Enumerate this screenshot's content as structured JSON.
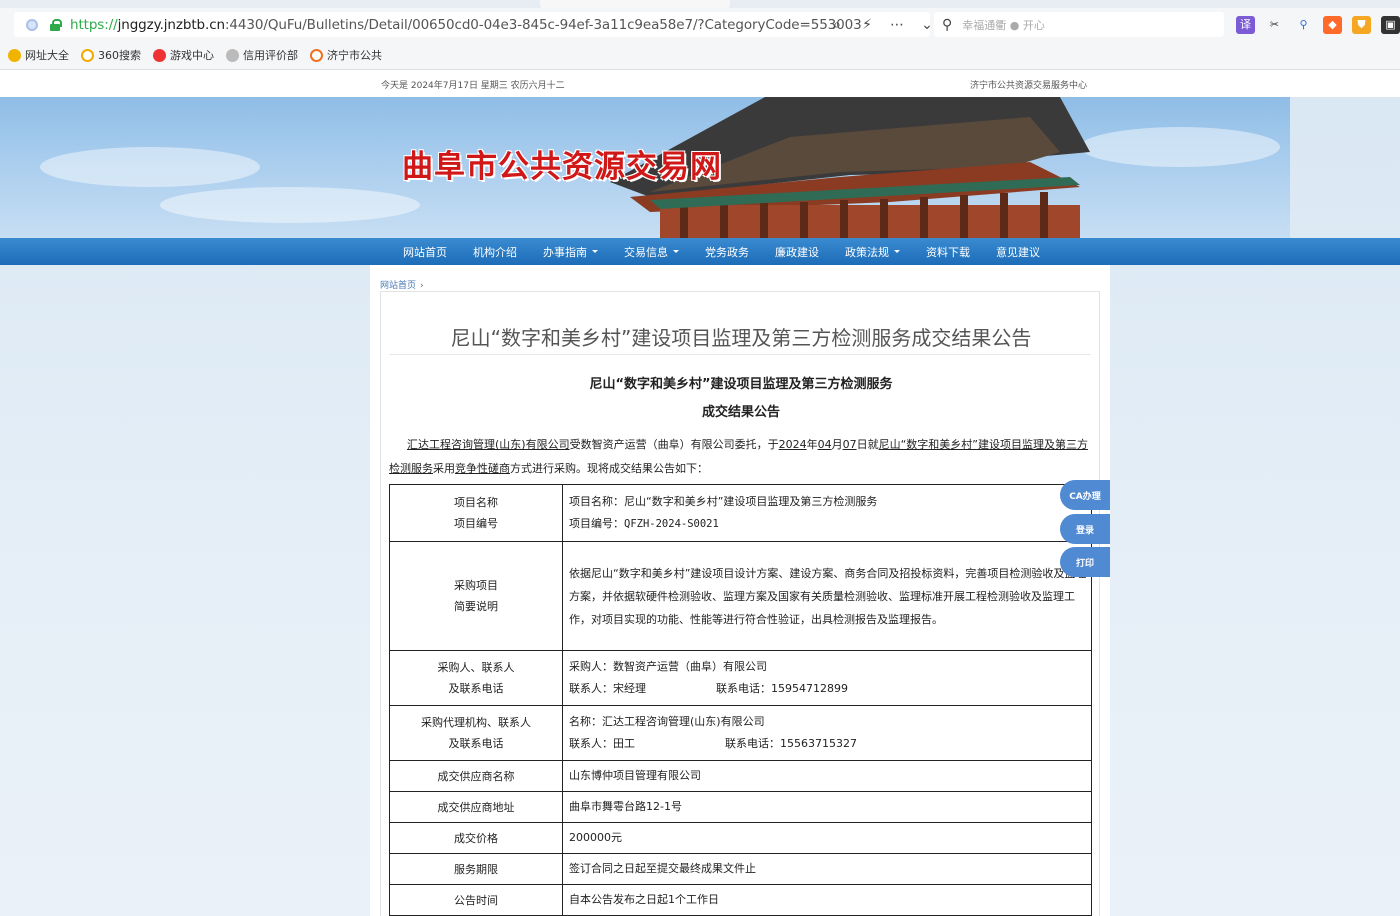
{
  "browser": {
    "url_protocol": "https://",
    "url_host": "jnggzy.jnzbtb.cn",
    "url_path": ":4430/QuFu/Bulletins/Detail/00650cd0-04e3-845c-94ef-3a11c9ea58e7/?CategoryCode=553003",
    "search_placeholder": "幸福通衢 ● 开心",
    "bookmarks": [
      "网址大全",
      "360搜索",
      "游戏中心",
      "信用评价部",
      "济宁市公共"
    ]
  },
  "site": {
    "date_line": "今天是  2024年7月17日  星期三  农历六月十二",
    "center_name": "济宁市公共资源交易服务中心",
    "banner_title": "曲阜市公共资源交易网",
    "nav": [
      {
        "label": "网站首页"
      },
      {
        "label": "机构介绍"
      },
      {
        "label": "办事指南",
        "dropdown": true
      },
      {
        "label": "交易信息",
        "dropdown": true
      },
      {
        "label": "党务政务"
      },
      {
        "label": "廉政建设"
      },
      {
        "label": "政策法规",
        "dropdown": true
      },
      {
        "label": "资料下载"
      },
      {
        "label": "意见建议"
      }
    ],
    "breadcrumb": "网站首页",
    "float_buttons": [
      "CA办理",
      "登录",
      "打印"
    ]
  },
  "notice": {
    "title": "尼山“数字和美乡村”建设项目监理及第三方检测服务成交结果公告",
    "subtitle1": "尼山“数字和美乡村”建设项目监理及第三方检测服务",
    "subtitle2": "成交结果公告",
    "intro": {
      "agent": "汇达工程咨询管理(山东)有限公司",
      "t1": "受数智资产运营（曲阜）有限公司委托，于",
      "year": "2024",
      "t2": "年",
      "month": "04",
      "t3": "月",
      "day": "07",
      "t4": "日就",
      "project": "尼山“数字和美乡村”建设项目监理及第三方检测服务",
      "t5": "采用",
      "method": "竞争性磋商",
      "t6": "方式进行采购。现将成交结果公告如下："
    },
    "table": [
      {
        "key": "项目名称\n项目编号",
        "value": "项目名称：尼山“数字和美乡村”建设项目监理及第三方检测服务\n项目编号：QFZH-2024-S0021"
      },
      {
        "key": "采购项目\n简要说明",
        "value": "依据尼山“数字和美乡村”建设项目设计方案、建设方案、商务合同及招投标资料，完善项目检测验收及监理方案，并依据软硬件检测验收、监理方案及国家有关质量检测验收、监理标准开展工程检测验收及监理工作，对项目实现的功能、性能等进行符合性验证，出具检测报告及监理报告。"
      },
      {
        "key": "采购人、联系人\n及联系电话",
        "value": "采购人：数智资产运营（曲阜）有限公司",
        "contact": "联系人：宋经理",
        "phone": "联系电话：15954712899"
      },
      {
        "key": "采购代理机构、联系人\n及联系电话",
        "value": "名称：汇达工程咨询管理(山东)有限公司",
        "contact": "联系人：田工",
        "phone": "联系电话：15563715327"
      },
      {
        "key": "成交供应商名称",
        "value": "山东博仲项目管理有限公司"
      },
      {
        "key": "成交供应商地址",
        "value": "曲阜市舞雩台路12-1号"
      },
      {
        "key": "成交价格",
        "value": "200000元"
      },
      {
        "key": "服务期限",
        "value": "签订合同之日起至提交最终成果文件止"
      },
      {
        "key": "公告时间",
        "value": "自本公告发布之日起1个工作日"
      }
    ]
  },
  "colors": {
    "nav_blue": "#1c6cb8",
    "banner_red": "#d01818",
    "float_blue": "#4f8ad2",
    "link_blue": "#4a7ab5"
  }
}
